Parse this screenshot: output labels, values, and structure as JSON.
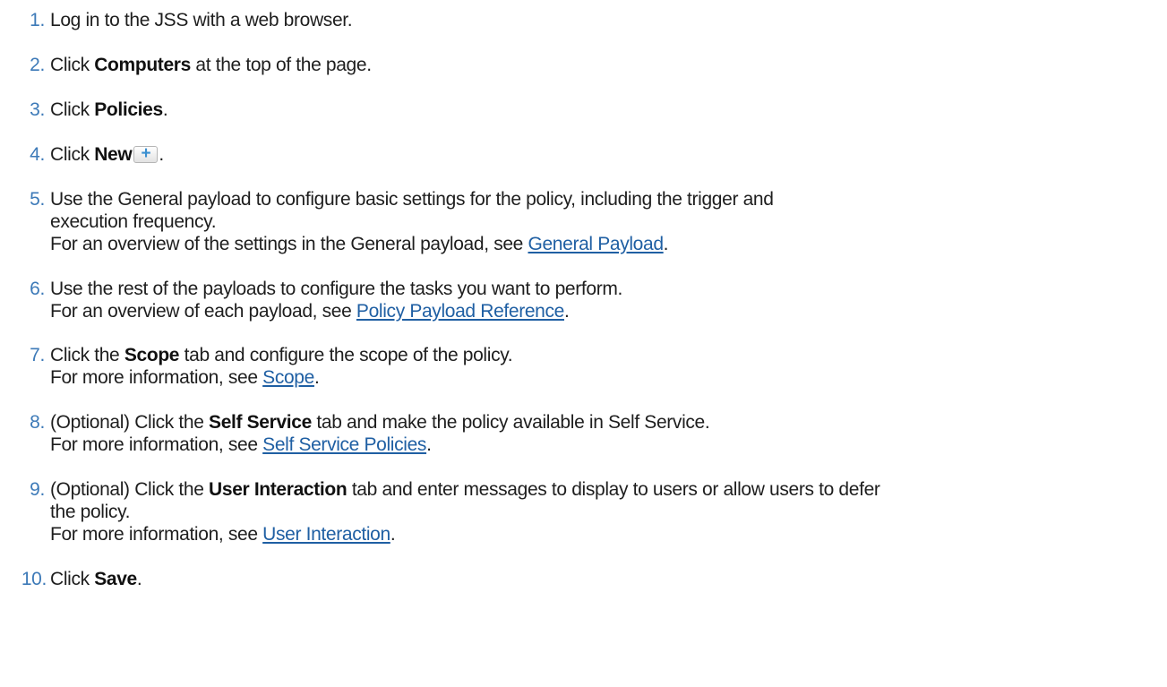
{
  "steps": [
    {
      "num": "1.",
      "pre": "Log in to the JSS with a web browser."
    },
    {
      "num": "2.",
      "pre": "Click ",
      "bold": "Computers",
      "post": " at the top of the page."
    },
    {
      "num": "3.",
      "pre": "Click ",
      "bold": "Policies",
      "post": "."
    },
    {
      "num": "4.",
      "pre": "Click ",
      "bold": "New",
      "post": ".",
      "icon": "plus-icon",
      "icon_glyph": "+"
    },
    {
      "num": "5.",
      "line1": "Use the General payload to configure basic settings for the policy, including the trigger and",
      "line2": "execution frequency.",
      "line3_pre": "For an overview of the settings in the General payload, see ",
      "link": "General Payload",
      "line3_post": "."
    },
    {
      "num": "6.",
      "line1": "Use the rest of the payloads to configure the tasks you want to perform.",
      "line2_pre": "For an overview of each payload, see ",
      "link": "Policy Payload Reference",
      "line2_post": "."
    },
    {
      "num": "7.",
      "line1_pre": "Click the ",
      "bold": "Scope",
      "line1_post": " tab and configure the scope of the policy.",
      "line2_pre": "For more information, see ",
      "link": "Scope",
      "line2_post": "."
    },
    {
      "num": "8.",
      "line1_pre": "(Optional) Click the ",
      "bold": "Self Service",
      "line1_post": " tab and make the policy available in Self Service.",
      "line2_pre": "For more information, see ",
      "link": "Self Service Policies",
      "line2_post": "."
    },
    {
      "num": "9.",
      "line1_pre": "(Optional) Click the ",
      "bold": "User Interaction",
      "line1_post": " tab and enter messages to display to users or allow users to defer",
      "line2": "the policy.",
      "line3_pre": "For more information, see ",
      "link": "User Interaction",
      "line3_post": "."
    },
    {
      "num": "10.",
      "pre": "Click ",
      "bold": "Save",
      "post": "."
    }
  ]
}
